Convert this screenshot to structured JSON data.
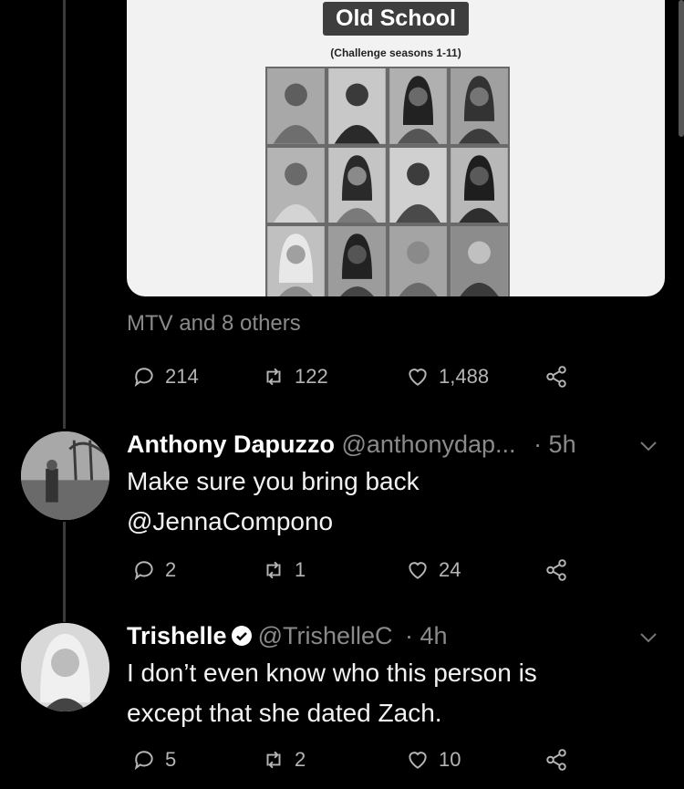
{
  "card": {
    "title": "Old School",
    "subtitle": "(Challenge seasons 1-11)"
  },
  "attribution": "MTV and 8 others",
  "main_actions": {
    "replies": "214",
    "retweets": "122",
    "likes": "1,488"
  },
  "tweets": [
    {
      "name": "Anthony Dapuzzo",
      "handle": "@anthonydap...",
      "time": "· 5h",
      "text_lines": [
        "Make sure you bring back",
        "@JennaCompono"
      ],
      "replies": "2",
      "retweets": "1",
      "likes": "24",
      "verified": false
    },
    {
      "name": "Trishelle",
      "handle": "@TrishelleC",
      "time": "· 4h",
      "text_lines": [
        "I don’t even know who this person is",
        "except that she dated Zach."
      ],
      "replies": "5",
      "retweets": "2",
      "likes": "10",
      "verified": true
    }
  ],
  "colors": {
    "background": "#000000",
    "text": "#f2f2f2",
    "muted": "#8a8a8a",
    "card": "#f2f2f2"
  },
  "icons": [
    "reply-icon",
    "retweet-icon",
    "like-icon",
    "share-icon",
    "chevron-down-icon",
    "verified-badge-icon"
  ]
}
